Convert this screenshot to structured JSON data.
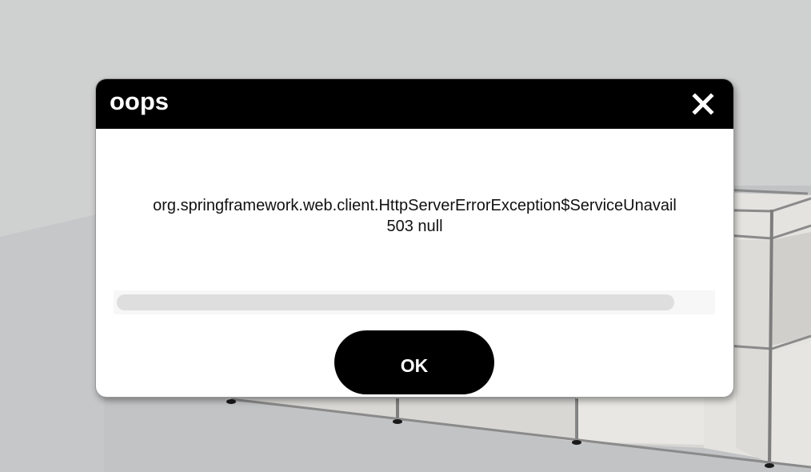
{
  "dialog": {
    "title": "oops",
    "close_icon": "close-x-icon",
    "message_line_1": "org.springframework.web.client.HttpServerErrorException$ServiceUnavail",
    "message_line_2": "503 null",
    "ok_label": "OK"
  },
  "colors": {
    "header_background": "#000000",
    "header_text": "#ffffff",
    "dialog_background": "#ffffff",
    "page_background": "#cfd0d0",
    "button_background": "#000000",
    "button_text": "#ffffff"
  }
}
